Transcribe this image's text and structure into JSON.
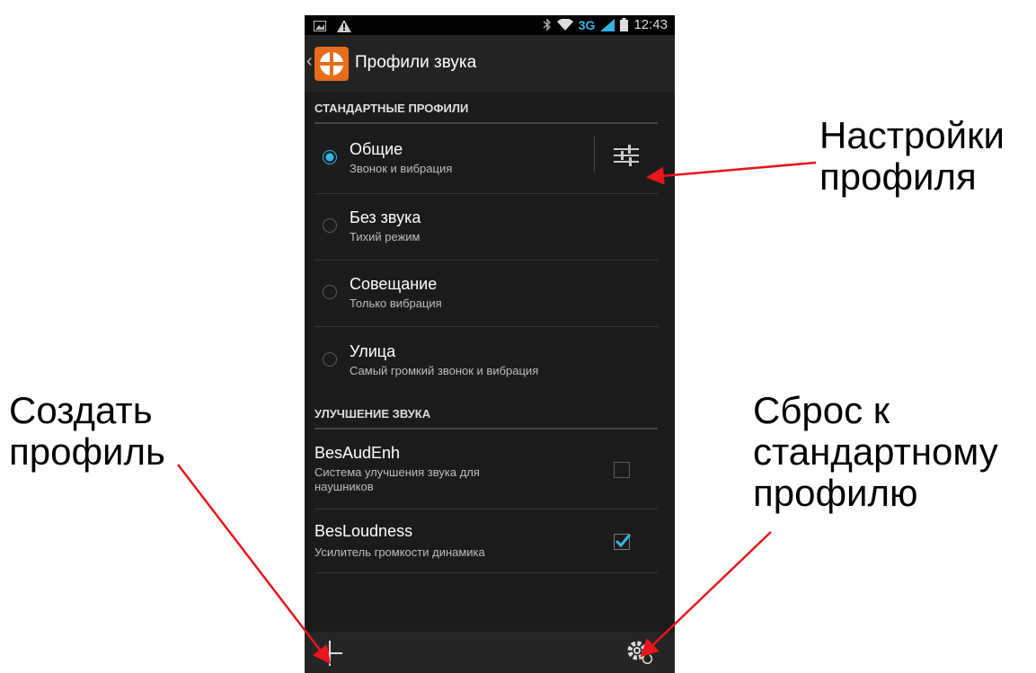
{
  "annotations": {
    "settings": [
      "Настройки",
      "профиля"
    ],
    "create": [
      "Создать",
      "профиль"
    ],
    "reset": [
      "Сброс к",
      "стандартному",
      "профилю"
    ],
    "arrow_color": "#e8161b"
  },
  "statusbar": {
    "network": "3G",
    "time": "12:43",
    "icons": [
      "image-notification-icon",
      "warning-icon",
      "bluetooth-icon",
      "wifi-icon",
      "signal-icon",
      "battery-icon"
    ]
  },
  "actionbar": {
    "title": "Профили звука",
    "back_icon": "chevron-left-icon",
    "app_icon": "sound-profiles-app-icon"
  },
  "sections": {
    "standard": "СТАНДАРТНЫЕ ПРОФИЛИ",
    "enhancement": "УЛУЧШЕНИЕ ЗВУКА"
  },
  "profiles": [
    {
      "title": "Общие",
      "subtitle": "Звонок и вибрация",
      "selected": true
    },
    {
      "title": "Без звука",
      "subtitle": "Тихий режим",
      "selected": false
    },
    {
      "title": "Совещание",
      "subtitle": "Только вибрация",
      "selected": false
    },
    {
      "title": "Улица",
      "subtitle": "Самый громкий звонок и вибрация",
      "selected": false
    }
  ],
  "enhancements": [
    {
      "title": "BesAudEnh",
      "subtitle_line1": "Система улучшения звука для",
      "subtitle_line2": "наушников",
      "checked": false
    },
    {
      "title": "BesLoudness",
      "subtitle_line1": "Усилитель громкости динамика",
      "checked": true
    }
  ],
  "colors": {
    "accent": "#33b5e5",
    "app_icon": "#e76d1c",
    "background": "#1b1b1b"
  }
}
